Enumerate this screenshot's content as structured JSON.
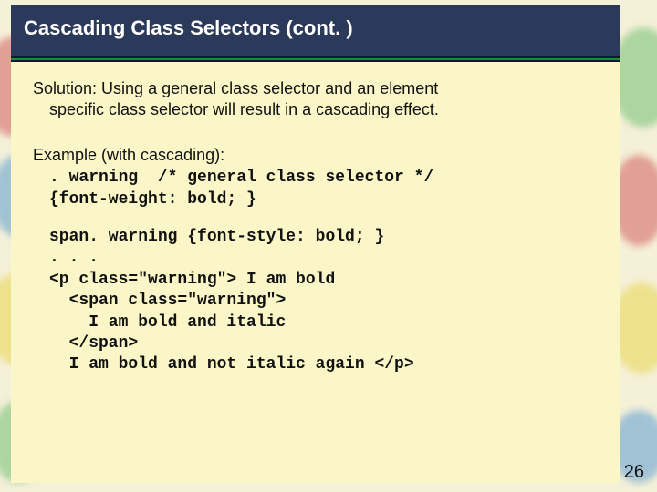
{
  "title": "Cascading Class Selectors (cont. )",
  "solution_line1": "Solution: Using a general class selector and an element",
  "solution_line2": "specific class selector will result in a cascading effect.",
  "example_label": "Example (with cascading):",
  "code1_line1": ". warning  /* general class selector */",
  "code1_line2": "{font-weight: bold; }",
  "code2_line1": "span. warning {font-style: bold; }",
  "code2_line2": ". . .",
  "code2_line3": "<p class=\"warning\"> I am bold",
  "code2_line4": "  <span class=\"warning\">",
  "code2_line5": "    I am bold and italic",
  "code2_line6": "  </span>",
  "code2_line7": "  I am bold and not italic again </p>",
  "page_number": "26"
}
